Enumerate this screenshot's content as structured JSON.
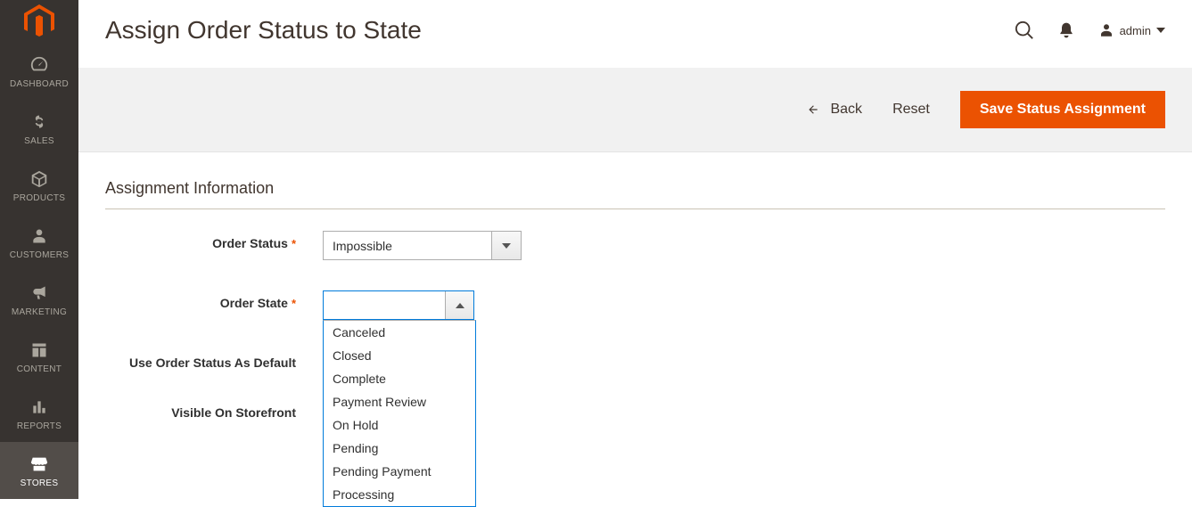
{
  "sidebar": {
    "items": [
      {
        "label": "Dashboard"
      },
      {
        "label": "Sales"
      },
      {
        "label": "Products"
      },
      {
        "label": "Customers"
      },
      {
        "label": "Marketing"
      },
      {
        "label": "Content"
      },
      {
        "label": "Reports"
      },
      {
        "label": "Stores"
      }
    ]
  },
  "header": {
    "title": "Assign Order Status to State",
    "user": "admin"
  },
  "actions": {
    "back": "Back",
    "reset": "Reset",
    "save": "Save Status Assignment"
  },
  "section": {
    "title": "Assignment Information"
  },
  "form": {
    "order_status": {
      "label": "Order Status",
      "value": "Impossible"
    },
    "order_state": {
      "label": "Order State",
      "value": "",
      "options": [
        "Canceled",
        "Closed",
        "Complete",
        "Payment Review",
        "On Hold",
        "Pending",
        "Pending Payment",
        "Processing"
      ]
    },
    "use_default": {
      "label": "Use Order Status As Default"
    },
    "visible_storefront": {
      "label": "Visible On Storefront"
    }
  }
}
